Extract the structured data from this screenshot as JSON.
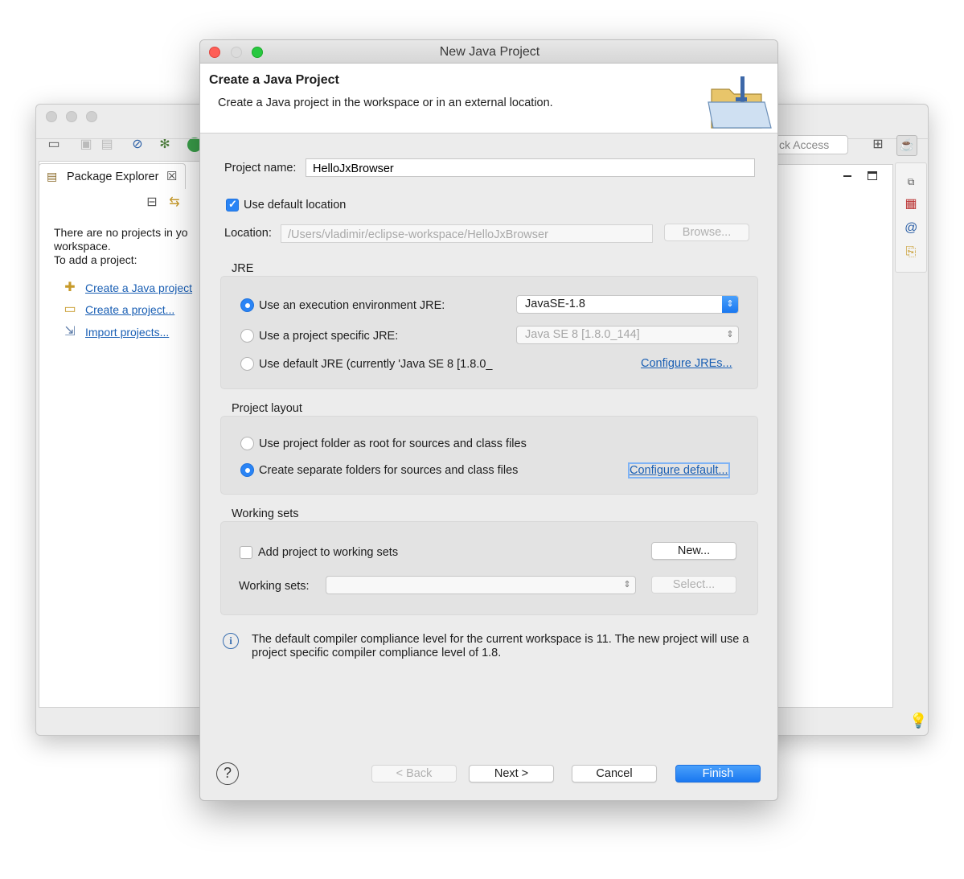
{
  "background_window": {
    "package_explorer": {
      "tab_label": "Package Explorer",
      "message_lines": [
        "There are no projects in yo",
        "workspace.",
        "To add a project:"
      ],
      "links": [
        "Create a Java project",
        "Create a project...",
        "Import projects..."
      ]
    },
    "quick_access_placeholder": "ck Access"
  },
  "dialog": {
    "window_title": "New Java Project",
    "banner": {
      "title": "Create a Java Project",
      "description": "Create a Java project in the workspace or in an external location."
    },
    "project_name": {
      "label": "Project name:",
      "value": "HelloJxBrowser"
    },
    "use_default_location": {
      "label": "Use default location",
      "checked": true
    },
    "location": {
      "label": "Location:",
      "value": "/Users/vladimir/eclipse-workspace/HelloJxBrowser",
      "browse_label": "Browse..."
    },
    "jre": {
      "title": "JRE",
      "options": [
        {
          "label": "Use an execution environment JRE:",
          "selected": true
        },
        {
          "label": "Use a project specific JRE:",
          "selected": false
        },
        {
          "label": "Use default JRE (currently 'Java SE 8 [1.8.0_",
          "selected": false
        }
      ],
      "execution_env_value": "JavaSE-1.8",
      "project_specific_value": "Java SE 8 [1.8.0_144]",
      "configure_link": "Configure JREs..."
    },
    "project_layout": {
      "title": "Project layout",
      "options": [
        {
          "label": "Use project folder as root for sources and class files",
          "selected": false
        },
        {
          "label": "Create separate folders for sources and class files",
          "selected": true
        }
      ],
      "configure_link": "Configure default..."
    },
    "working_sets": {
      "title": "Working sets",
      "add_label": "Add project to working sets",
      "add_checked": false,
      "new_button": "New...",
      "sets_label": "Working sets:",
      "sets_value": "",
      "select_button": "Select..."
    },
    "info_message": "The default compiler compliance level for the current workspace is 11. The new project will use a project specific compiler compliance level of 1.8.",
    "buttons": {
      "back": "< Back",
      "next": "Next >",
      "cancel": "Cancel",
      "finish": "Finish"
    },
    "colors": {
      "accent": "#2a84f5",
      "link": "#1a5fb4"
    }
  }
}
